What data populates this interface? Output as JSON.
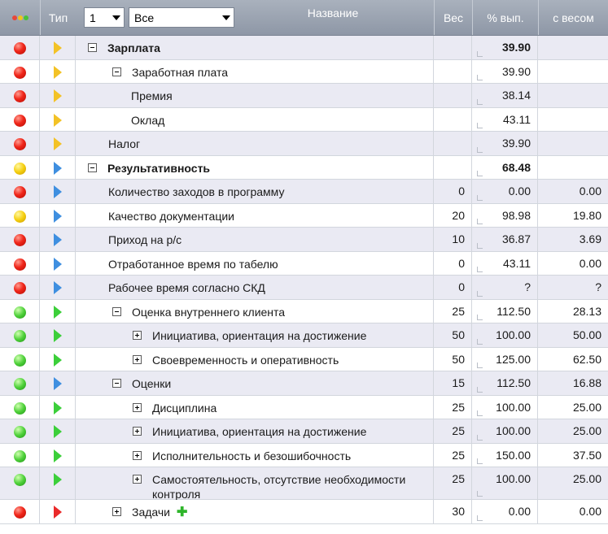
{
  "header": {
    "col_type": "Тип",
    "level_value": "1",
    "filter_value": "Все",
    "col_name": "Название",
    "col_weight": "Вес",
    "col_percent": "% вып.",
    "col_weighted": "с весом",
    "status_dot_colors": [
      "#e8483a",
      "#f2c31b",
      "#48c23a"
    ]
  },
  "rows": [
    {
      "lamp": "red",
      "flag": "yellow",
      "level": 0,
      "toggle": "minus",
      "name": "Зарплата",
      "bold": true,
      "weight": "",
      "percent": "39.90",
      "weighted": ""
    },
    {
      "lamp": "red",
      "flag": "yellow",
      "level": 1,
      "toggle": "minus",
      "name": "Заработная плата",
      "bold": false,
      "weight": "",
      "percent": "39.90",
      "weighted": ""
    },
    {
      "lamp": "red",
      "flag": "yellow",
      "level": 2,
      "toggle": "",
      "name": "Премия",
      "bold": false,
      "weight": "",
      "percent": "38.14",
      "weighted": ""
    },
    {
      "lamp": "red",
      "flag": "yellow",
      "level": 2,
      "toggle": "",
      "name": "Оклад",
      "bold": false,
      "weight": "",
      "percent": "43.11",
      "weighted": ""
    },
    {
      "lamp": "red",
      "flag": "yellow",
      "level": 1,
      "toggle": "",
      "name": "Налог",
      "bold": false,
      "weight": "",
      "percent": "39.90",
      "weighted": ""
    },
    {
      "lamp": "yellow",
      "flag": "blue",
      "level": 0,
      "toggle": "minus",
      "name": "Результативность",
      "bold": true,
      "weight": "",
      "percent": "68.48",
      "weighted": ""
    },
    {
      "lamp": "red",
      "flag": "blue",
      "level": 1,
      "toggle": "",
      "name": "Количество заходов в программу",
      "bold": false,
      "weight": "0",
      "percent": "0.00",
      "weighted": "0.00"
    },
    {
      "lamp": "yellow",
      "flag": "blue",
      "level": 1,
      "toggle": "",
      "name": "Качество документации",
      "bold": false,
      "weight": "20",
      "percent": "98.98",
      "weighted": "19.80"
    },
    {
      "lamp": "red",
      "flag": "blue",
      "level": 1,
      "toggle": "",
      "name": "Приход на р/с",
      "bold": false,
      "weight": "10",
      "percent": "36.87",
      "weighted": "3.69"
    },
    {
      "lamp": "red",
      "flag": "blue",
      "level": 1,
      "toggle": "",
      "name": "Отработанное время по табелю",
      "bold": false,
      "weight": "0",
      "percent": "43.11",
      "weighted": "0.00"
    },
    {
      "lamp": "red",
      "flag": "blue",
      "level": 1,
      "toggle": "",
      "name": "Рабочее время согласно СКД",
      "bold": false,
      "weight": "0",
      "percent": "?",
      "weighted": "?"
    },
    {
      "lamp": "green",
      "flag": "green",
      "level": 1,
      "toggle": "minus",
      "name": "Оценка внутреннего клиента",
      "bold": false,
      "weight": "25",
      "percent": "112.50",
      "weighted": "28.13"
    },
    {
      "lamp": "green",
      "flag": "green",
      "level": 2,
      "toggle": "plus",
      "name": "Инициатива, ориентация на достижение",
      "bold": false,
      "weight": "50",
      "percent": "100.00",
      "weighted": "50.00"
    },
    {
      "lamp": "green",
      "flag": "green",
      "level": 2,
      "toggle": "plus",
      "name": "Своевременность и оперативность",
      "bold": false,
      "weight": "50",
      "percent": "125.00",
      "weighted": "62.50"
    },
    {
      "lamp": "green",
      "flag": "blue",
      "level": 1,
      "toggle": "minus",
      "name": "Оценки",
      "bold": false,
      "weight": "15",
      "percent": "112.50",
      "weighted": "16.88"
    },
    {
      "lamp": "green",
      "flag": "green",
      "level": 2,
      "toggle": "plus",
      "name": "Дисциплина",
      "bold": false,
      "weight": "25",
      "percent": "100.00",
      "weighted": "25.00"
    },
    {
      "lamp": "green",
      "flag": "green",
      "level": 2,
      "toggle": "plus",
      "name": "Инициатива, ориентация на достижение",
      "bold": false,
      "weight": "25",
      "percent": "100.00",
      "weighted": "25.00"
    },
    {
      "lamp": "green",
      "flag": "green",
      "level": 2,
      "toggle": "plus",
      "name": "Исполнительность и безошибочность",
      "bold": false,
      "weight": "25",
      "percent": "150.00",
      "weighted": "37.50"
    },
    {
      "lamp": "green",
      "flag": "green",
      "level": 2,
      "toggle": "plus",
      "name": "Самостоятельность, отсутствие необходимости контроля",
      "bold": false,
      "weight": "25",
      "percent": "100.00",
      "weighted": "25.00",
      "tall": true
    },
    {
      "lamp": "red",
      "flag": "red",
      "level": 1,
      "toggle": "plus",
      "name": "Задачи",
      "bold": false,
      "weight": "30",
      "percent": "0.00",
      "weighted": "0.00",
      "add": true
    }
  ]
}
